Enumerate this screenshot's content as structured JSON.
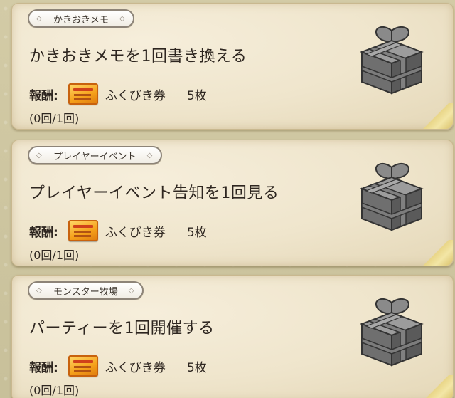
{
  "missions": [
    {
      "category": "かきおきメモ",
      "title": "かきおきメモを1回書き換える",
      "reward_label": "報酬:",
      "reward_name": "ふくびき券",
      "reward_count": "5枚",
      "progress": "(0回/1回)",
      "icon": "gift-box-icon"
    },
    {
      "category": "プレイヤーイベント",
      "title": "プレイヤーイベント告知を1回見る",
      "reward_label": "報酬:",
      "reward_name": "ふくびき券",
      "reward_count": "5枚",
      "progress": "(0回/1回)",
      "icon": "gift-box-icon"
    },
    {
      "category": "モンスター牧場",
      "title": "パーティーを1回開催する",
      "reward_label": "報酬:",
      "reward_name": "ふくびき券",
      "reward_count": "5枚",
      "progress": "(0回/1回)",
      "icon": "gift-box-icon"
    }
  ],
  "colors": {
    "background": "#cfc7a3",
    "card": "#efe5cc",
    "text": "#2e2620",
    "tag_border": "#8d8478",
    "ticket": "#f5a01a",
    "gift": "#6f6f6f"
  }
}
